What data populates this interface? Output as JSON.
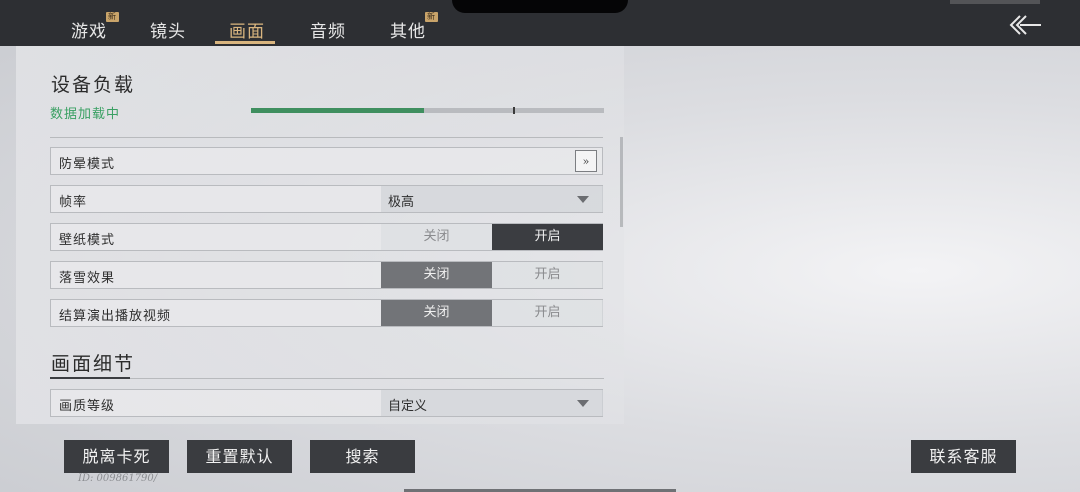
{
  "tabs": [
    {
      "label": "游戏",
      "badge": "新"
    },
    {
      "label": "镜头",
      "badge": ""
    },
    {
      "label": "画面",
      "badge": ""
    },
    {
      "label": "音频",
      "badge": ""
    },
    {
      "label": "其他",
      "badge": "新"
    }
  ],
  "active_tab": "画面",
  "icons": {
    "back": "back-arrow-icon",
    "expand": "double-chevron-right-icon",
    "dropdown": "caret-down-icon"
  },
  "device_load": {
    "title": "设备负载",
    "status": "数据加载中",
    "progress": 0.49,
    "status_color": "#3aa063"
  },
  "settings": {
    "anti_lag": {
      "label": "防晕模式",
      "button": "»"
    },
    "frame_rate": {
      "label": "帧率",
      "value": "极高"
    },
    "wallpaper": {
      "label": "壁纸模式",
      "off": "关闭",
      "on": "开启",
      "selected": "开启"
    },
    "snow": {
      "label": "落雪效果",
      "off": "关闭",
      "on": "开启",
      "selected": "关闭"
    },
    "ending_video": {
      "label": "结算演出播放视频",
      "off": "关闭",
      "on": "开启",
      "selected": "关闭"
    }
  },
  "detail": {
    "title": "画面细节",
    "quality": {
      "label": "画质等级",
      "value": "自定义"
    }
  },
  "buttons": {
    "unstuck": "脱离卡死",
    "reset": "重置默认",
    "search": "搜索",
    "contact": "联系客服"
  },
  "user_id": "ID: 009861790/",
  "colors": {
    "accent": "#d9b57f",
    "topbar": "#2d2f33",
    "button": "#3a3c40",
    "progress": "#3f8f5f"
  }
}
